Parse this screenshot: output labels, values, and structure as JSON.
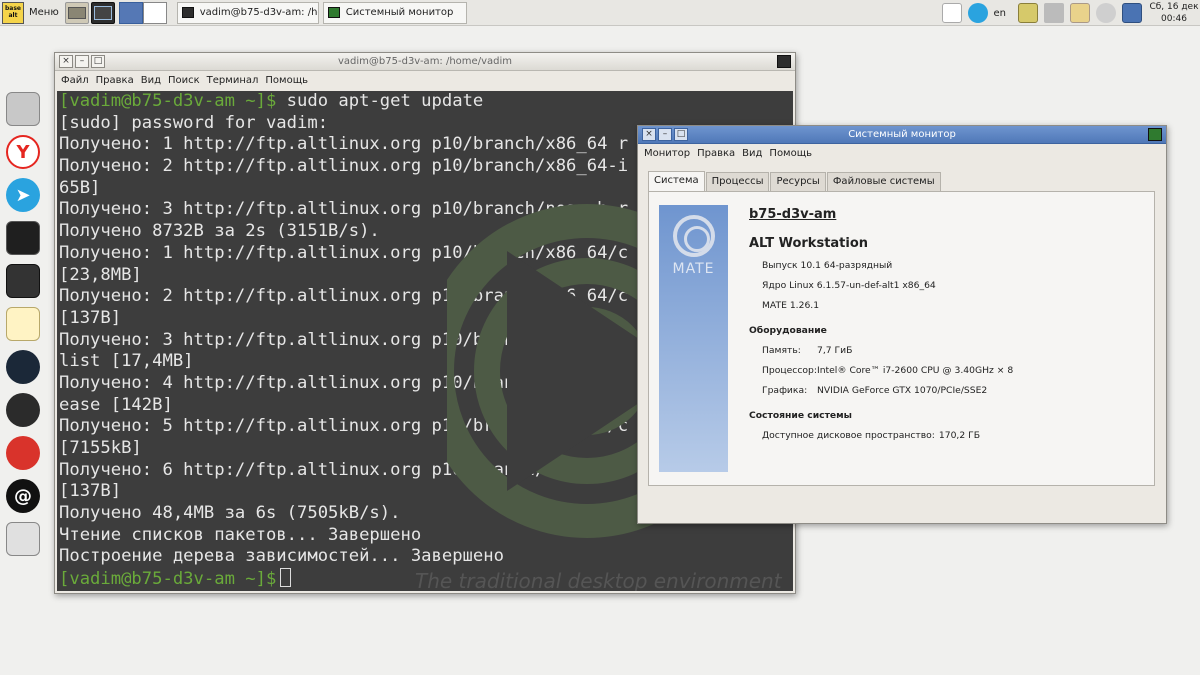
{
  "panel": {
    "menu_label": "Меню",
    "tasks": [
      "vadim@b75-d3v-am: /hom...",
      "Системный монитор"
    ],
    "lang": "en",
    "date": "Сб, 16 дек",
    "time": "00:46",
    "logo_text": "base alt"
  },
  "dock": {
    "icons": [
      "file-manager-icon",
      "yandex-browser-icon",
      "telegram-icon",
      "terminal-icon",
      "app-tiles-icon",
      "text-editor-icon",
      "steam-icon",
      "obs-icon",
      "red-app-icon",
      "at-app-icon",
      "package-installer-icon"
    ]
  },
  "terminal": {
    "title": "vadim@b75-d3v-am: /home/vadim",
    "menu": [
      "Файл",
      "Правка",
      "Вид",
      "Поиск",
      "Терминал",
      "Помощь"
    ],
    "prompt": "[vadim@b75-d3v-am ~]$",
    "command": " sudo apt-get update",
    "lines": [
      "[sudo] password for vadim:",
      "Получено: 1 http://ftp.altlinux.org p10/branch/x86_64 r",
      "Получено: 2 http://ftp.altlinux.org p10/branch/x86_64-i",
      "65B]",
      "Получено: 3 http://ftp.altlinux.org p10/branch/noarch r",
      "Получено 8732B за 2s (3151B/s).",
      "Получено: 1 http://ftp.altlinux.org p10/branch/x86_64/c",
      "[23,8MB]",
      "Получено: 2 http://ftp.altlinux.org p10/branch/x86_64/c",
      "[137B]",
      "Получено: 3 http://ftp.altlinux.org p10/branch/x86_64-i",
      "list [17,4MB]",
      "Получено: 4 http://ftp.altlinux.org p10/branch/x86_64-i",
      "ease [142B]",
      "Получено: 5 http://ftp.altlinux.org p10/branch/noarch/c",
      "[7155kB]",
      "Получено: 6 http://ftp.altlinux.org p10/branch/noarch/c",
      "[137B]",
      "Получено 48,4MB за 6s (7505kB/s).",
      "Чтение списков пакетов... Завершено",
      "Построение дерева зависимостей... Завершено"
    ],
    "watermark": "The traditional desktop environment"
  },
  "monitor": {
    "title": "Системный монитор",
    "menu": [
      "Монитор",
      "Правка",
      "Вид",
      "Помощь"
    ],
    "tabs": [
      "Система",
      "Процессы",
      "Ресурсы",
      "Файловые системы"
    ],
    "logo_label": "MATE",
    "hostname": "b75-d3v-am",
    "distro": "ALT Workstation",
    "release": "Выпуск 10.1 64-разрядный",
    "kernel": "Ядро Linux 6.1.57-un-def-alt1 x86_64",
    "mate_version": "MATE 1.26.1",
    "hardware_title": "Оборудование",
    "memory_label": "Память:",
    "memory_value": "7,7 ГиБ",
    "cpu_label": "Процессор:",
    "cpu_value": "Intel® Core™ i7-2600 CPU @ 3.40GHz × 8",
    "gpu_label": "Графика:",
    "gpu_value": "NVIDIA GeForce GTX 1070/PCIe/SSE2",
    "status_title": "Состояние системы",
    "disk_label": "Доступное дисковое пространство:",
    "disk_value": "170,2 ГБ"
  }
}
